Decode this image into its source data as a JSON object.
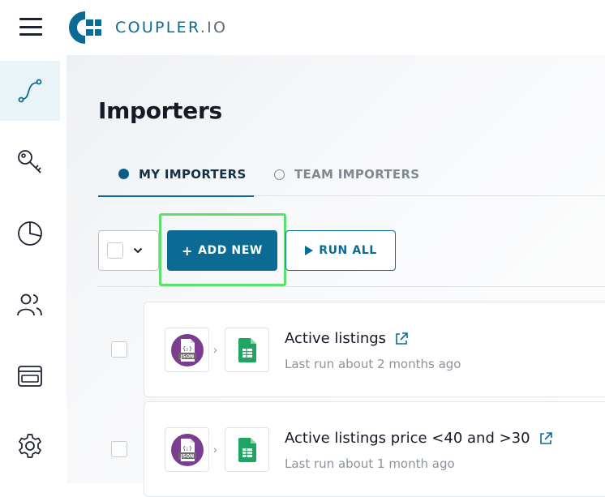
{
  "header": {
    "logo_main": "COUPLER",
    "logo_suffix": ".IO"
  },
  "sidebar": {
    "items": [
      {
        "name": "importers",
        "icon": "flow-curve-icon",
        "active": true
      },
      {
        "name": "keys",
        "icon": "key-icon",
        "active": false
      },
      {
        "name": "analytics",
        "icon": "pie-chart-icon",
        "active": false
      },
      {
        "name": "team",
        "icon": "users-icon",
        "active": false
      },
      {
        "name": "billing",
        "icon": "credit-card-icon",
        "active": false
      },
      {
        "name": "settings",
        "icon": "gear-icon",
        "active": false
      }
    ]
  },
  "main": {
    "title": "Importers",
    "tabs": [
      {
        "label": "MY IMPORTERS",
        "active": true
      },
      {
        "label": "TEAM IMPORTERS",
        "active": false
      }
    ],
    "toolbar": {
      "add_label": "ADD NEW",
      "add_icon": "+",
      "run_label": "RUN ALL"
    },
    "importers": [
      {
        "title": "Active listings",
        "subtitle": "Last run about 2 months ago",
        "source_icon": "json-icon",
        "dest_icon": "google-sheets-icon"
      },
      {
        "title": "Active listings price <40 and >30",
        "subtitle": "Last run about 1 month ago",
        "source_icon": "json-icon",
        "dest_icon": "google-sheets-icon"
      }
    ],
    "json_icon_label": "JSON",
    "json_icon_glyph": "{;}"
  },
  "colors": {
    "brand": "#0b6b94",
    "highlight": "#5be06b",
    "json_purple": "#7b3d8f",
    "sheets_green": "#1fa463"
  }
}
